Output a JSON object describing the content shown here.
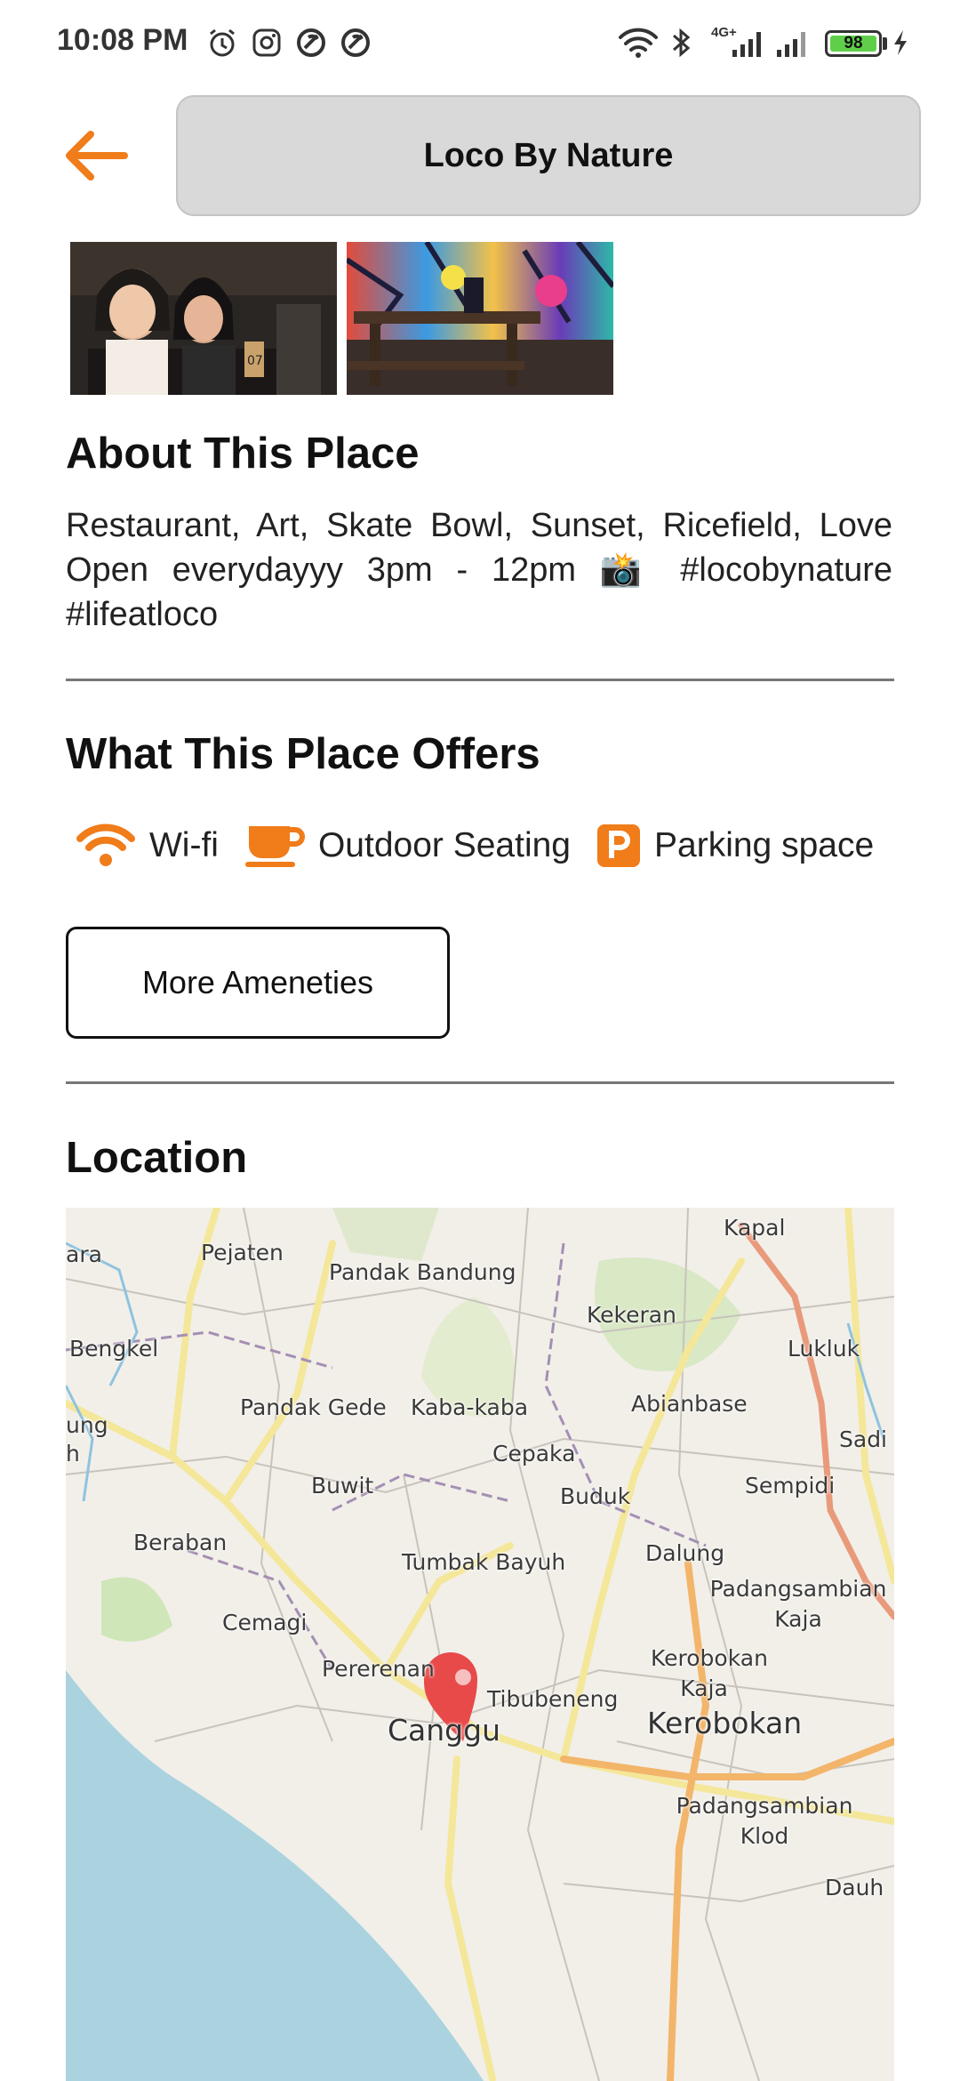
{
  "status_bar": {
    "time": "10:08 PM",
    "battery": "98",
    "network": "4G+",
    "icons_left": [
      "alarm-icon",
      "instagram-icon",
      "app-notification-icon",
      "app-notification-icon"
    ],
    "icons_right": [
      "wifi-icon",
      "bluetooth-icon",
      "signal-icon",
      "signal-icon",
      "battery-icon",
      "charging-icon"
    ]
  },
  "header": {
    "back_icon": "arrow-left-icon",
    "title": "Loco By Nature"
  },
  "photos": [
    "people-at-bar-photo",
    "colorful-mural-table-photo"
  ],
  "about": {
    "heading": "About This Place",
    "text": "Restaurant, Art, Skate Bowl, Sunset, Ricefield, Love Open everydayyy 3pm - 12pm 📸 #locobynature #lifeatloco"
  },
  "offers": {
    "heading": "What This Place Offers",
    "amenities": [
      {
        "label": "Wi-fi",
        "icon": "wifi-icon"
      },
      {
        "label": "Outdoor Seating",
        "icon": "coffee-cup-icon"
      },
      {
        "label": "Parking space",
        "icon": "parking-icon"
      }
    ],
    "more_button": "More Ameneties"
  },
  "location": {
    "heading": "Location",
    "map_labels": [
      "Kapal",
      "ara",
      "Pejaten",
      "Pandak Bandung",
      "Kekeran",
      "Bengkel",
      "Lukluk",
      "Pandak Gede",
      "Kaba-kaba",
      "Abianbase",
      "ung",
      "h",
      "Sadi",
      "Cepaka",
      "Buwit",
      "Buduk",
      "Sempidi",
      "Beraban",
      "Tumbak Bayuh",
      "Dalung",
      "Padangsambian Kaja",
      "Cemagi",
      "Kerobokan Kaja",
      "Pererenan",
      "Tibubeneng",
      "Canggu",
      "Kerobokan",
      "Padangsambian Klod",
      "Dauh"
    ],
    "colors": {
      "sea": "#aad3df",
      "land": "#f2efe9",
      "pin": "#e84a4a",
      "accent": "#f07c1a"
    }
  }
}
